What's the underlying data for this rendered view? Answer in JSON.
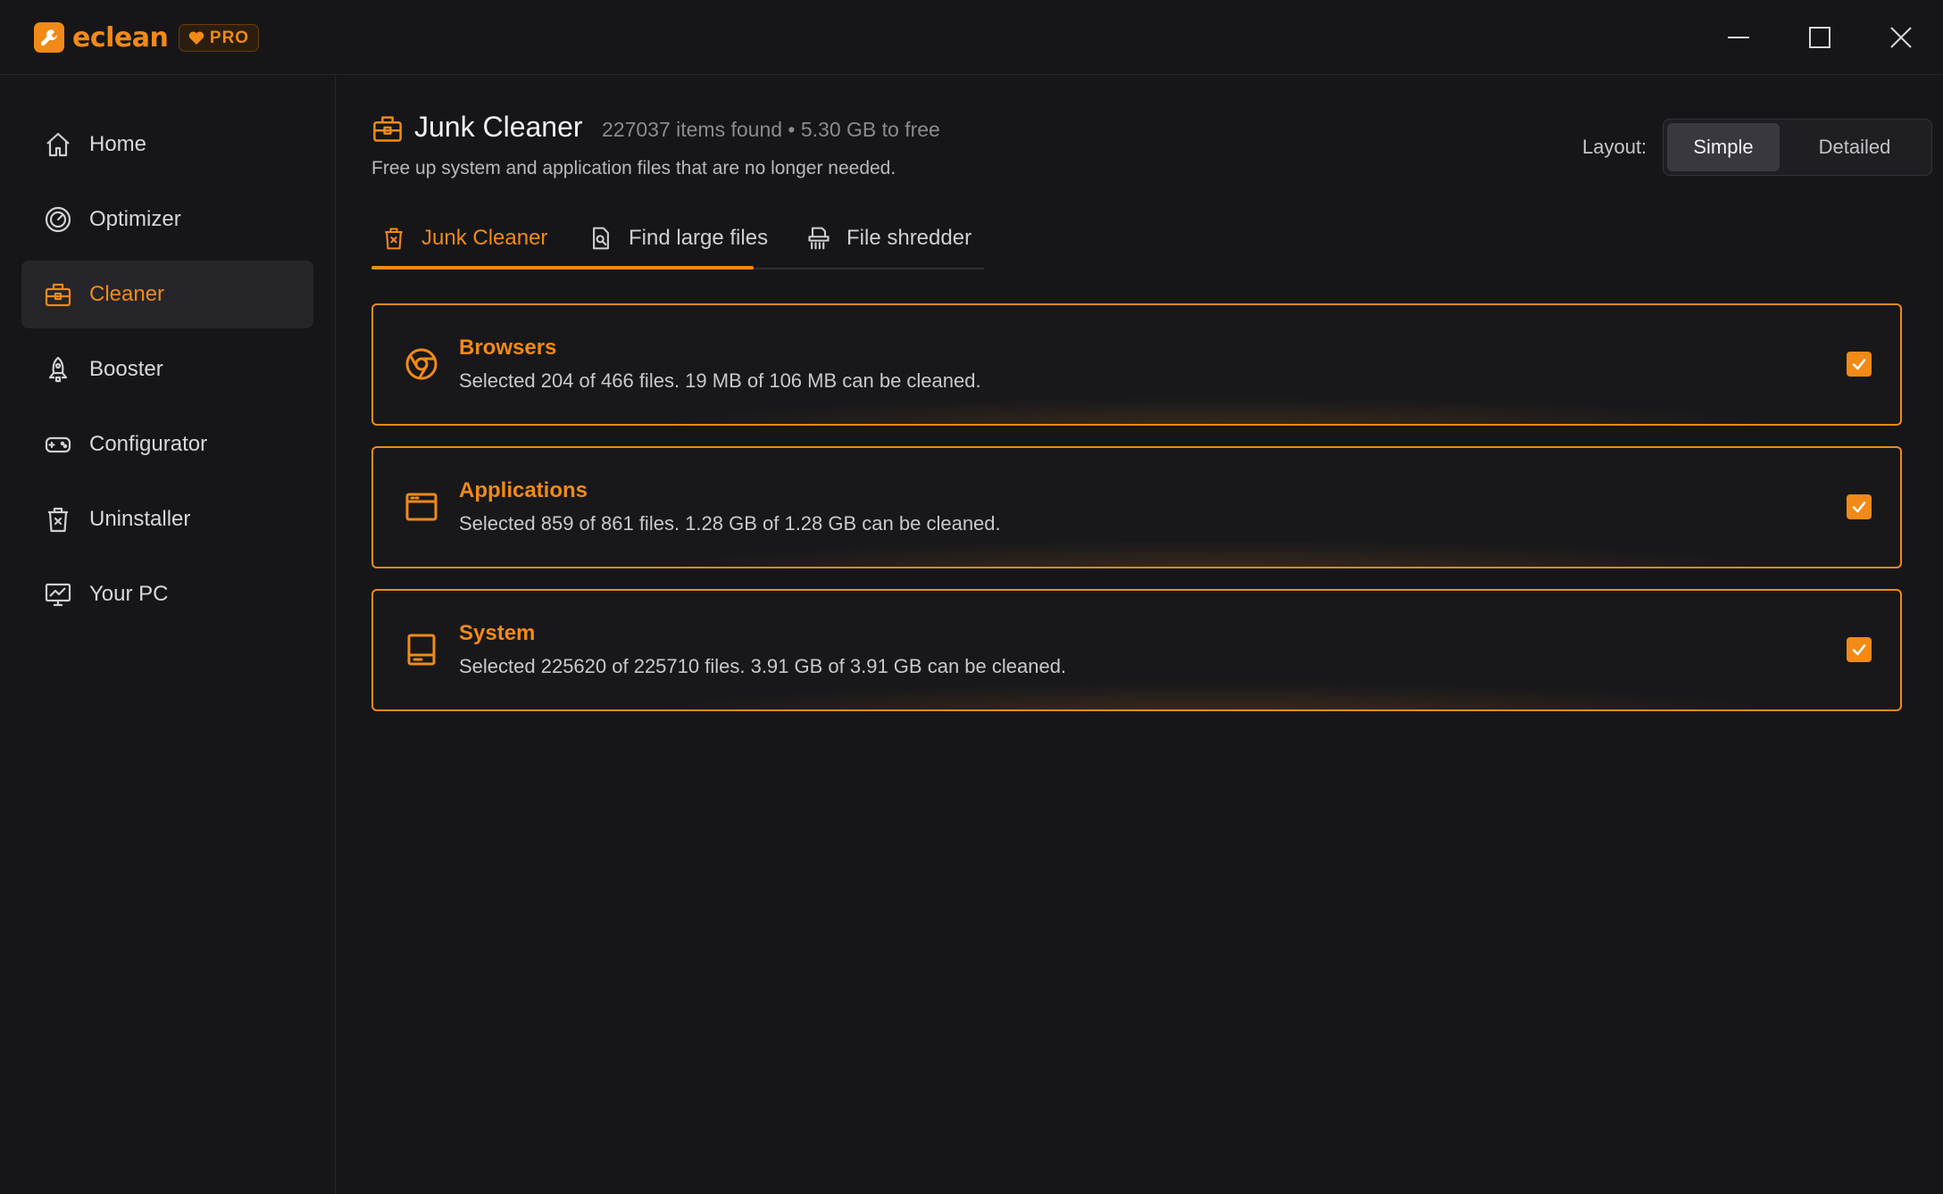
{
  "app": {
    "logo_text": "eclean",
    "pro_label": "PRO",
    "accent": "#f18a17"
  },
  "window_controls": [
    "minimize-icon",
    "maximize-icon",
    "close-icon"
  ],
  "sidebar": {
    "items": [
      {
        "label": "Home",
        "icon": "home-icon",
        "active": false
      },
      {
        "label": "Optimizer",
        "icon": "gauge-icon",
        "active": false
      },
      {
        "label": "Cleaner",
        "icon": "toolbox-icon",
        "active": true
      },
      {
        "label": "Booster",
        "icon": "rocket-icon",
        "active": false
      },
      {
        "label": "Configurator",
        "icon": "gamepad-icon",
        "active": false
      },
      {
        "label": "Uninstaller",
        "icon": "trash-icon",
        "active": false
      },
      {
        "label": "Your PC",
        "icon": "monitor-chart-icon",
        "active": false
      }
    ]
  },
  "header": {
    "title": "Junk Cleaner",
    "stats": "227037 items found • 5.30 GB to free",
    "subtitle": "Free up system and application files that are no longer needed."
  },
  "layout_toggle": {
    "label": "Layout:",
    "options": [
      "Simple",
      "Detailed"
    ],
    "selected": "Simple"
  },
  "tabs": [
    {
      "label": "Junk Cleaner",
      "icon": "trash-box-icon",
      "active": true
    },
    {
      "label": "Find large files",
      "icon": "file-search-icon",
      "active": false
    },
    {
      "label": "File shredder",
      "icon": "shredder-icon",
      "active": false
    }
  ],
  "categories": [
    {
      "title": "Browsers",
      "desc": "Selected 204 of 466 files. 19 MB of 106 MB can be cleaned.",
      "icon": "chrome-icon",
      "checked": true
    },
    {
      "title": "Applications",
      "desc": "Selected 859 of 861 files. 1.28 GB of 1.28 GB can be cleaned.",
      "icon": "window-icon",
      "checked": true
    },
    {
      "title": "System",
      "desc": "Selected 225620 of 225710 files. 3.91 GB of 3.91 GB can be cleaned.",
      "icon": "drive-icon",
      "checked": true
    }
  ]
}
